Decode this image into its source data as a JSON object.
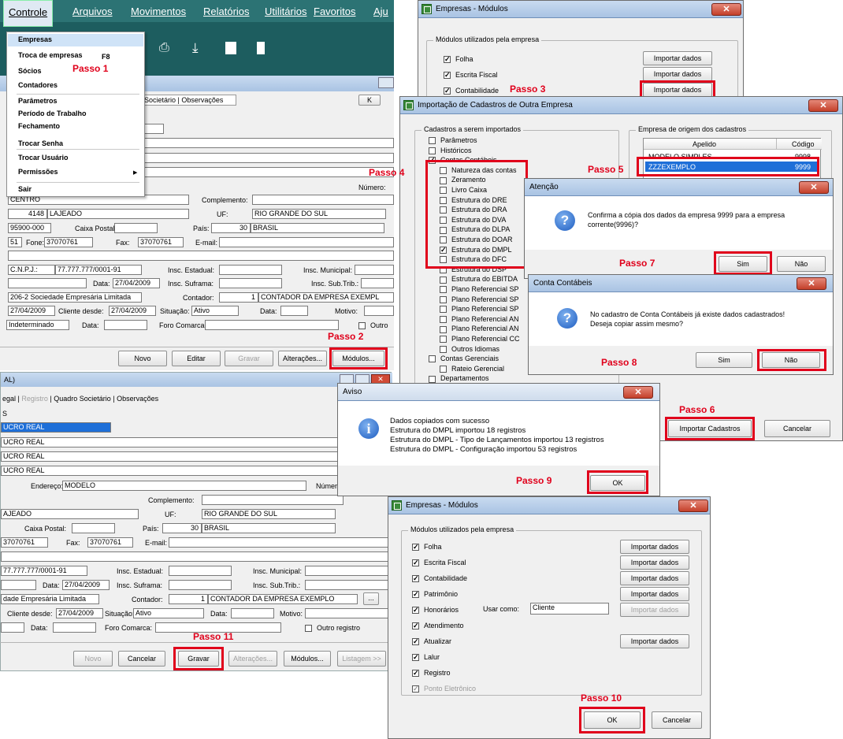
{
  "main_menu": {
    "items": [
      "Controle",
      "Arquivos",
      "Movimentos",
      "Relatórios",
      "Utilitários",
      "Favoritos",
      "Aju"
    ],
    "dropdown": [
      {
        "label": "Empresas"
      },
      {
        "label": "Troca de empresas",
        "shortcut": "F8"
      },
      {
        "label": "Sócios"
      },
      {
        "label": "Contadores"
      },
      {
        "label": "Parâmetros"
      },
      {
        "label": "Período de Trabalho"
      },
      {
        "label": "Fechamento"
      },
      {
        "label": "Trocar Senha"
      },
      {
        "label": "Trocar Usuário"
      },
      {
        "label": "Permissões"
      },
      {
        "label": "Sair"
      }
    ]
  },
  "steps": {
    "p1": "Passo 1",
    "p2": "Passo 2",
    "p3": "Passo 3",
    "p4": "Passo 4",
    "p5": "Passo 5",
    "p6": "Passo 6",
    "p7": "Passo 7",
    "p8": "Passo 8",
    "p9": "Passo 9",
    "p10": "Passo 10",
    "p11": "Passo 11"
  },
  "company_form_top": {
    "tabs": "Societário | Observações",
    "nav_k": "K",
    "numero_label": "Número:",
    "bairro": "CENTRO",
    "complemento_label": "Complemento:",
    "cidade_code": "4148",
    "cidade": "LAJEADO",
    "uf_label": "UF:",
    "uf": "RIO GRANDE DO SUL",
    "cep": "95900-000",
    "caixa_postal_label": "Caixa Postal:",
    "pais_label": "País:",
    "pais_code": "30",
    "pais": "BRASIL",
    "ddd": "51",
    "fone_label": "Fone:",
    "fone": "37070761",
    "fax_label": "Fax:",
    "fax": "37070761",
    "email_label": "E-mail:",
    "cnpj_label": "C.N.P.J.:",
    "cnpj": "77.777.777/0001-91",
    "insc_estadual_label": "Insc. Estadual:",
    "insc_municipal_label": "Insc. Municipal:",
    "data_label": "Data:",
    "data": "27/04/2009",
    "insc_suframa_label": "Insc. Suframa:",
    "insc_subtrib_label": "Insc. Sub.Trib.:",
    "natureza": "206-2 Sociedade Empresária Limitada",
    "contador_label": "Contador:",
    "contador_code": "1",
    "contador": "CONTADOR DA EMPRESA EXEMPL",
    "inicio": "27/04/2009",
    "cliente_desde_label": "Cliente desde:",
    "cliente_desde": "27/04/2009",
    "situacao_label": "Situação:",
    "situacao": "Ativo",
    "motivo_label": "Motivo:",
    "prazo": "Indeterminado",
    "foro_label": "Foro Comarca:",
    "outro_label": "Outro",
    "buttons": {
      "novo": "Novo",
      "editar": "Editar",
      "gravar": "Gravar",
      "alteracoes": "Alterações...",
      "modulos": "Módulos..."
    }
  },
  "company_form_bottom": {
    "title": "AL)",
    "tabs": [
      "egal",
      "Registro",
      "Quadro Societário",
      "Observações"
    ],
    "letter": "S",
    "f1": "UCRO REAL",
    "f2": "UCRO REAL",
    "f3": "UCRO REAL",
    "f4": "UCRO REAL",
    "endereco_label": "Endereço:",
    "endereco": "MODELO",
    "numero_label": "Número:",
    "complemento_label": "Complemento:",
    "cidade": "AJEADO",
    "uf_label": "UF:",
    "uf": "RIO GRANDE DO SUL",
    "caixa_postal_label": "Caixa Postal:",
    "pais_label": "País:",
    "pais_code": "30",
    "pais": "BRASIL",
    "fone": "37070761",
    "fax_label": "Fax:",
    "fax": "37070761",
    "email_label": "E-mail:",
    "cnpj": "77.777.777/0001-91",
    "insc_estadual_label": "Insc. Estadual:",
    "insc_municipal_label": "Insc. Municipal:",
    "data_label": "Data:",
    "data": "27/04/2009",
    "insc_suframa_label": "Insc. Suframa:",
    "insc_subtrib_label": "Insc. Sub.Trib.:",
    "natureza": "dade Empresária Limitada",
    "contador_label": "Contador:",
    "contador_code": "1",
    "contador": "CONTADOR DA EMPRESA EXEMPLO",
    "cliente_desde_label": "Cliente desde:",
    "cliente_desde": "27/04/2009",
    "situacao_label": "Situação:",
    "situacao": "Ativo",
    "motivo_label": "Motivo:",
    "foro_label": "Foro Comarca:",
    "outro_label": "Outro registro",
    "buttons": {
      "novo": "Novo",
      "cancelar": "Cancelar",
      "gravar": "Gravar",
      "alteracoes": "Alterações...",
      "modulos": "Módulos...",
      "listagem": "Listagem >>"
    }
  },
  "modulos_top": {
    "title": "Empresas - Módulos",
    "group_label": "Módulos utilizados pela empresa",
    "items": [
      "Folha",
      "Escrita Fiscal",
      "Contabilidade"
    ],
    "import_label": "Importar dados"
  },
  "importacao": {
    "title": "Importação de Cadastros de Outra Empresa",
    "left_group": "Cadastros a serem importados",
    "right_group": "Empresa de origem dos cadastros",
    "col_apelido": "Apelido",
    "col_codigo": "Código",
    "rows": [
      {
        "apelido": "MODELO SIMPLES",
        "codigo": "9998"
      },
      {
        "apelido": "ZZZEXEMPLO",
        "codigo": "9999"
      }
    ],
    "tree": [
      {
        "label": "Parâmetros",
        "level": 0,
        "checked": false
      },
      {
        "label": "Históricos",
        "level": 0,
        "checked": false
      },
      {
        "label": "Contas Contábeis",
        "level": 0,
        "checked": true
      },
      {
        "label": "Natureza das contas",
        "level": 1,
        "checked": false
      },
      {
        "label": "Zeramento",
        "level": 1,
        "checked": false
      },
      {
        "label": "Livro Caixa",
        "level": 1,
        "checked": false
      },
      {
        "label": "Estrutura do DRE",
        "level": 1,
        "checked": false
      },
      {
        "label": "Estrutura do DRA",
        "level": 1,
        "checked": false
      },
      {
        "label": "Estrutura do DVA",
        "level": 1,
        "checked": false
      },
      {
        "label": "Estrutura do DLPA",
        "level": 1,
        "checked": false
      },
      {
        "label": "Estrutura do DOAR",
        "level": 1,
        "checked": false
      },
      {
        "label": "Estrutura do DMPL",
        "level": 1,
        "checked": true
      },
      {
        "label": "Estrutura do DFC",
        "level": 1,
        "checked": false
      },
      {
        "label": "Estrutura do DSP",
        "level": 1,
        "checked": false
      },
      {
        "label": "Estrutura do EBITDA",
        "level": 1,
        "checked": false
      },
      {
        "label": "Plano Referencial SP",
        "level": 1,
        "checked": false
      },
      {
        "label": "Plano Referencial SP",
        "level": 1,
        "checked": false
      },
      {
        "label": "Plano Referencial SP",
        "level": 1,
        "checked": false
      },
      {
        "label": "Plano Referencial AN",
        "level": 1,
        "checked": false
      },
      {
        "label": "Plano Referencial AN",
        "level": 1,
        "checked": false
      },
      {
        "label": "Plano Referencial CC",
        "level": 1,
        "checked": false
      },
      {
        "label": "Outros Idiomas",
        "level": 1,
        "checked": false
      },
      {
        "label": "Contas Gerenciais",
        "level": 0,
        "checked": false
      },
      {
        "label": "Rateio Gerencial",
        "level": 1,
        "checked": false
      },
      {
        "label": "Departamentos",
        "level": 0,
        "checked": false
      }
    ],
    "btn_importar": "Importar Cadastros",
    "btn_cancelar": "Cancelar"
  },
  "atencao": {
    "title": "Atenção",
    "message": "Confirma a cópia dos dados da empresa 9999 para a empresa corrente(9996)?",
    "btn_sim": "Sim",
    "btn_nao": "Não"
  },
  "conta_contabeis": {
    "title": "Conta Contábeis",
    "line1": "No cadastro de Conta Contábeis já existe dados cadastrados!",
    "line2": "Deseja copiar assim mesmo?",
    "btn_sim": "Sim",
    "btn_nao": "Não"
  },
  "aviso": {
    "title": "Aviso",
    "lines": [
      "Dados copiados com sucesso",
      "Estrutura do DMPL importou 18 registros",
      "Estrutura do DMPL - Tipo de Lançamentos importou 13 registros",
      "Estrutura do DMPL - Configuração importou 53 registros"
    ],
    "btn_ok": "OK"
  },
  "modulos_bottom": {
    "title": "Empresas - Módulos",
    "group_label": "Módulos utilizados pela empresa",
    "items": [
      {
        "label": "Folha",
        "checked": true,
        "import": "Importar dados",
        "import_enabled": true
      },
      {
        "label": "Escrita Fiscal",
        "checked": true,
        "import": "Importar dados",
        "import_enabled": true
      },
      {
        "label": "Contabilidade",
        "checked": true,
        "import": "Importar dados",
        "import_enabled": true
      },
      {
        "label": "Patrimônio",
        "checked": true,
        "import": "Importar dados",
        "import_enabled": true
      },
      {
        "label": "Honorários",
        "checked": true,
        "import": "Importar dados",
        "import_enabled": false
      },
      {
        "label": "Atendimento",
        "checked": true,
        "import": "",
        "import_enabled": false
      },
      {
        "label": "Atualizar",
        "checked": true,
        "import": "Importar dados",
        "import_enabled": true
      },
      {
        "label": "Lalur",
        "checked": true,
        "import": "",
        "import_enabled": false
      },
      {
        "label": "Registro",
        "checked": true,
        "import": "",
        "import_enabled": false
      },
      {
        "label": "Ponto Eletrônico",
        "checked": true,
        "import": "",
        "import_enabled": false
      }
    ],
    "usar_como_label": "Usar como:",
    "usar_como": "Cliente",
    "btn_ok": "OK",
    "btn_cancelar": "Cancelar"
  }
}
